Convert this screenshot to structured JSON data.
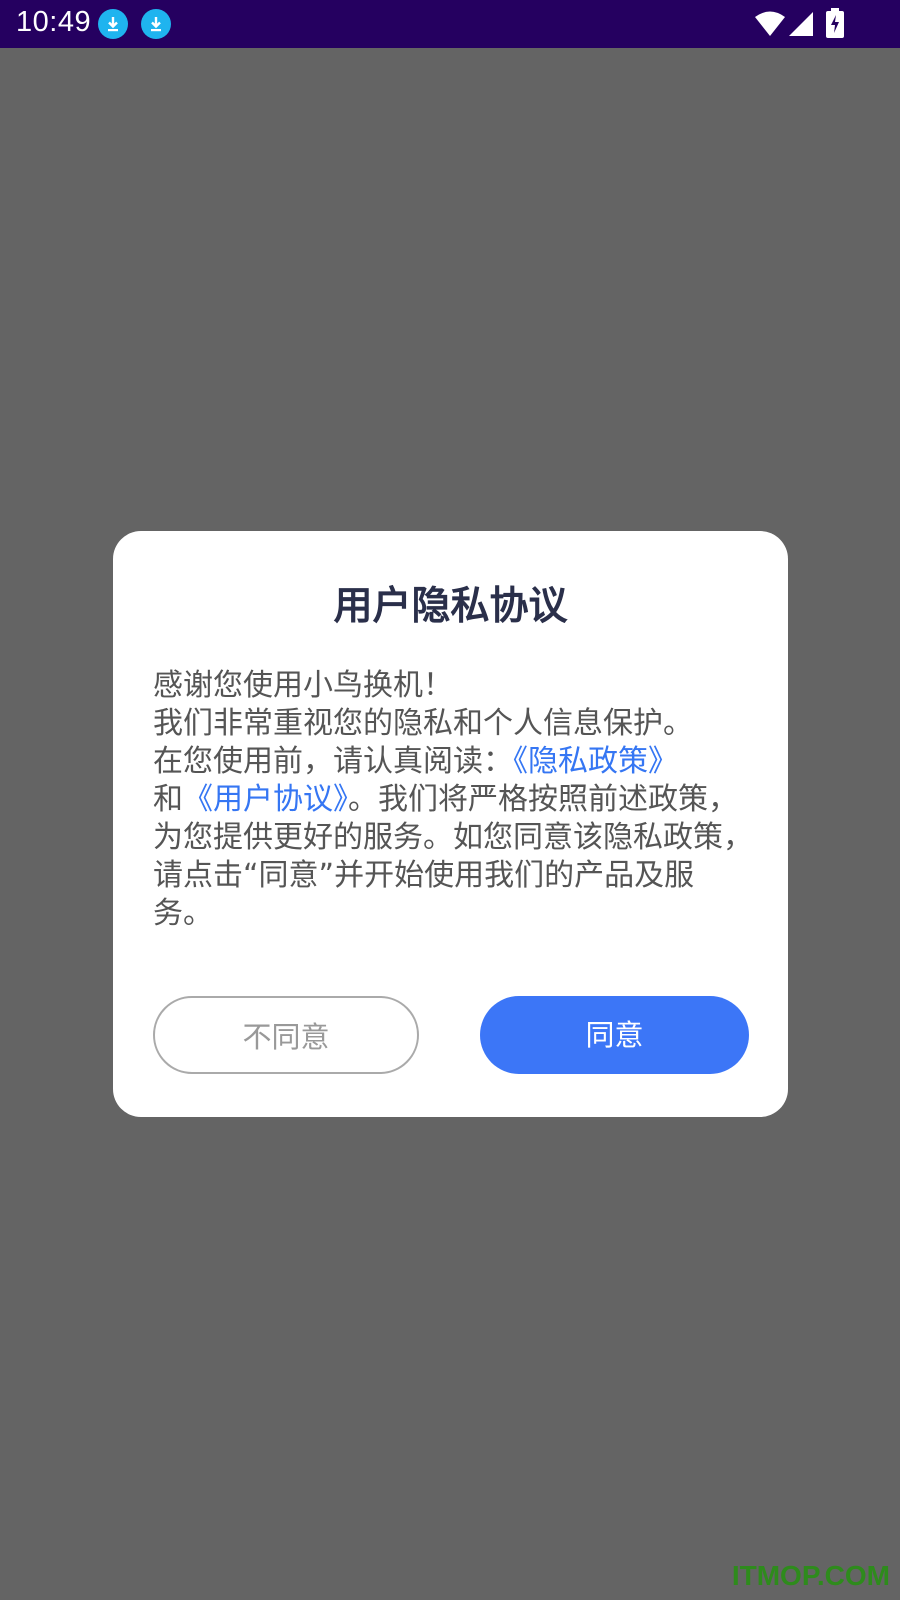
{
  "status_bar": {
    "time": "10:49"
  },
  "dialog": {
    "title": "用户隐私协议",
    "body": {
      "line1": "感谢您使用小鸟换机！",
      "line2": "我们非常重视您的隐私和个人信息保护。",
      "line3_prefix": "在您使用前，请认真阅读：",
      "privacy_link": "《隐私政策》",
      "and_text": "和",
      "user_agreement_link": "《用户协议》",
      "remainder": "。我们将严格按照前述政策，为您提供更好的服务。如您同意该隐私政策，请点击“同意”并开始使用我们的产品及服务。"
    },
    "disagree_label": "不同意",
    "agree_label": "同意"
  },
  "watermark": "ITMOP.COM",
  "colors": {
    "status_bar": "#250060",
    "overlay": "#646464",
    "accent": "#3c76f7",
    "link": "#3576f3"
  }
}
